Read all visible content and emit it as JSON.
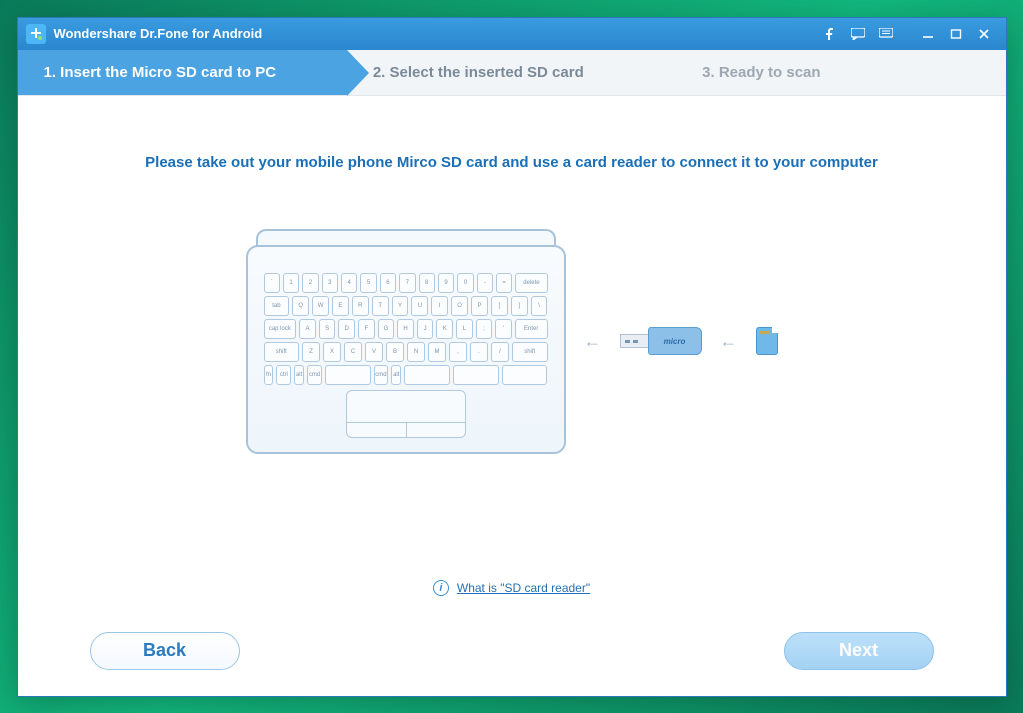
{
  "title": "Wondershare Dr.Fone for Android",
  "steps": [
    {
      "label": "1. Insert the Micro SD card to PC",
      "state": "active"
    },
    {
      "label": "2. Select the inserted SD card",
      "state": "next"
    },
    {
      "label": "3. Ready to scan",
      "state": "idle"
    }
  ],
  "instruction": "Please take out your mobile phone Mirco SD card and use a card reader to connect it to your computer",
  "usb_label": "micro",
  "info_link": "What is \"SD card reader\"",
  "buttons": {
    "back": "Back",
    "next": "Next"
  },
  "keyrows": [
    [
      "`",
      "1",
      "2",
      "3",
      "4",
      "5",
      "6",
      "7",
      "8",
      "9",
      "0",
      "-",
      "=",
      "delete"
    ],
    [
      "tab",
      "Q",
      "W",
      "E",
      "R",
      "T",
      "Y",
      "U",
      "I",
      "O",
      "P",
      "[",
      "]",
      "\\"
    ],
    [
      "cap lock",
      "A",
      "S",
      "D",
      "F",
      "G",
      "H",
      "J",
      "K",
      "L",
      ";",
      "'",
      "Enter"
    ],
    [
      "shift",
      "Z",
      "X",
      "C",
      "V",
      "B",
      "N",
      "M",
      ",",
      ".",
      "/",
      "shift"
    ],
    [
      "fn",
      "ctrl",
      "alt",
      "cmd",
      "",
      "cmd",
      "alt",
      "",
      "",
      ""
    ]
  ]
}
